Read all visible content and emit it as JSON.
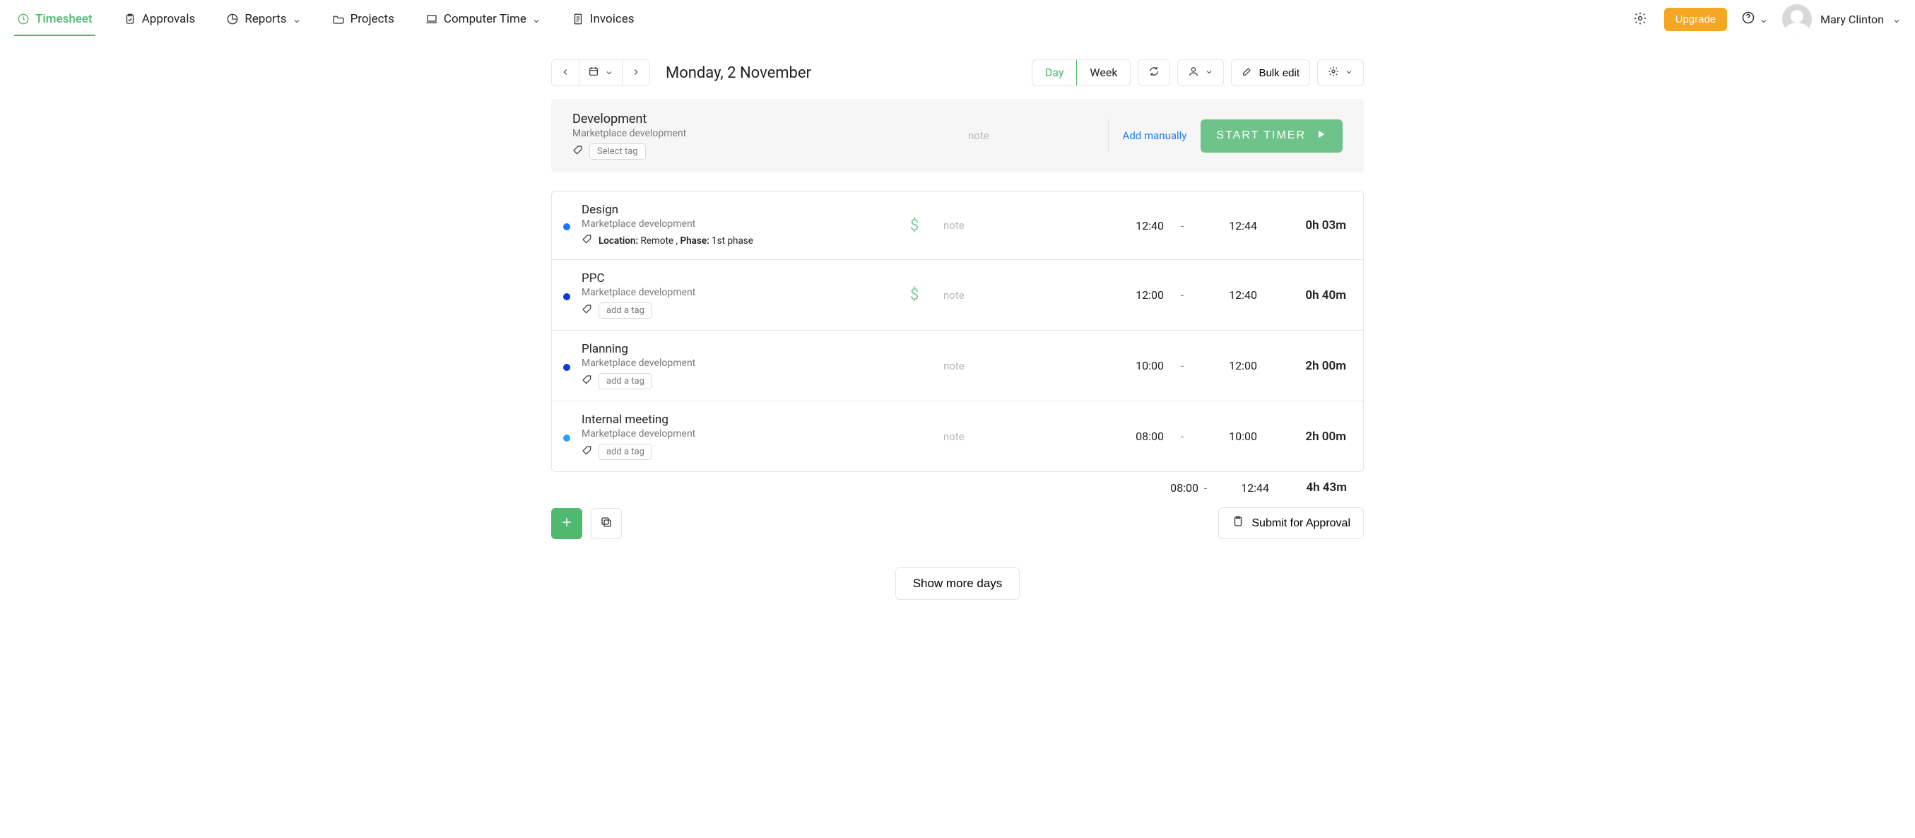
{
  "nav": {
    "timesheet": "Timesheet",
    "approvals": "Approvals",
    "reports": "Reports",
    "projects": "Projects",
    "computer_time": "Computer Time",
    "invoices": "Invoices",
    "upgrade": "Upgrade",
    "user_name": "Mary Clinton"
  },
  "toolbar": {
    "date_title": "Monday, 2 November",
    "day": "Day",
    "week": "Week",
    "bulk_edit": "Bulk edit"
  },
  "entry_form": {
    "task": "Development",
    "project": "Marketplace development",
    "select_tag": "Select tag",
    "note_placeholder": "note",
    "add_manually": "Add manually",
    "start_timer": "START TIMER"
  },
  "entries": [
    {
      "task": "Design",
      "project": "Marketplace development",
      "tag_text_parts": [
        "Location:",
        " Remote , ",
        "Phase:",
        " 1st phase"
      ],
      "billable": true,
      "note_placeholder": "note",
      "start": "12:40",
      "dash": "-",
      "end": "12:44",
      "duration": "0h 03m",
      "dot": "blue-mid",
      "add_tag_label": null
    },
    {
      "task": "PPC",
      "project": "Marketplace development",
      "add_tag_label": "add a tag",
      "billable": true,
      "note_placeholder": "note",
      "start": "12:00",
      "dash": "-",
      "end": "12:40",
      "duration": "0h 40m",
      "dot": "blue-solid"
    },
    {
      "task": "Planning",
      "project": "Marketplace development",
      "add_tag_label": "add a tag",
      "billable": false,
      "note_placeholder": "note",
      "start": "10:00",
      "dash": "-",
      "end": "12:00",
      "duration": "2h 00m",
      "dot": "blue-solid"
    },
    {
      "task": "Internal meeting",
      "project": "Marketplace development",
      "add_tag_label": "add a tag",
      "billable": false,
      "note_placeholder": "note",
      "start": "08:00",
      "dash": "-",
      "end": "10:00",
      "duration": "2h 00m",
      "dot": "blue-sky"
    }
  ],
  "totals": {
    "start": "08:00",
    "dash": "-",
    "end": "12:44",
    "duration": "4h 43m"
  },
  "bottom": {
    "submit": "Submit for Approval",
    "show_more": "Show more days"
  }
}
